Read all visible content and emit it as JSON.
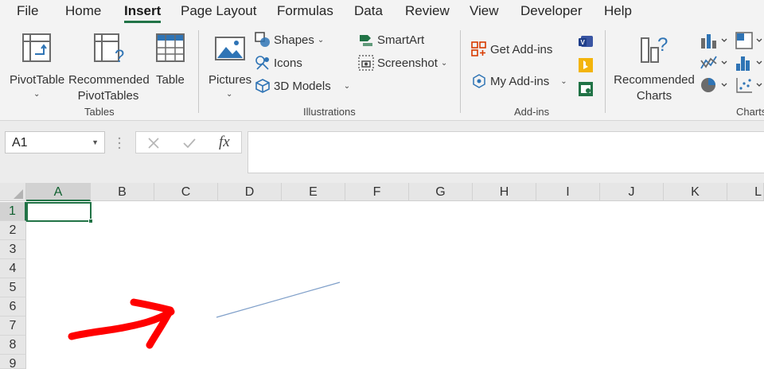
{
  "menu": {
    "tabs": [
      {
        "label": "File"
      },
      {
        "label": "Home"
      },
      {
        "label": "Insert",
        "active": true
      },
      {
        "label": "Page Layout"
      },
      {
        "label": "Formulas"
      },
      {
        "label": "Data"
      },
      {
        "label": "Review"
      },
      {
        "label": "View"
      },
      {
        "label": "Developer"
      },
      {
        "label": "Help"
      }
    ]
  },
  "ribbon": {
    "tables": {
      "label": "Tables",
      "pivottable": "PivotTable",
      "recommended_line1": "Recommended",
      "recommended_line2": "PivotTables",
      "table": "Table"
    },
    "illustrations": {
      "label": "Illustrations",
      "pictures": "Pictures",
      "shapes": "Shapes",
      "icons": "Icons",
      "models": "3D Models",
      "smartart": "SmartArt",
      "screenshot": "Screenshot"
    },
    "addins": {
      "label": "Add-ins",
      "get": "Get Add-ins",
      "my": "My Add-ins"
    },
    "charts": {
      "label": "Charts",
      "recommended_line1": "Recommended",
      "recommended_line2": "Charts"
    }
  },
  "formula_bar": {
    "name_box": "A1",
    "fx": "fx",
    "value": ""
  },
  "grid": {
    "columns": [
      "A",
      "B",
      "C",
      "D",
      "E",
      "F",
      "G",
      "H",
      "I",
      "J",
      "K",
      "L"
    ],
    "rows": [
      "1",
      "2",
      "3",
      "4",
      "5",
      "6",
      "7",
      "8",
      "9"
    ],
    "selected_cell": "A1"
  },
  "colors": {
    "accent": "#217346",
    "annotation_arrow": "#ff0000",
    "connector_line": "#7f9fc9"
  }
}
